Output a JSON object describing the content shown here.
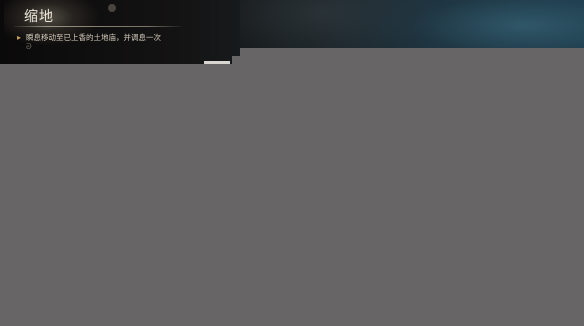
{
  "skill": {
    "title": "缩地",
    "description": "瞬息移动至已上香的土地庙，并调息一次",
    "arrow_icon": "▸",
    "swirl_icon": "ᘐ"
  },
  "colors": {
    "mask_gray": "#676565",
    "title_text": "#ece6da",
    "description_text": "#d8cfbf",
    "arrow_gold": "#c9a15a",
    "scene_teal": "#214050"
  },
  "icons": [
    "arrow-icon",
    "swirl-icon",
    "ink-burst-icon"
  ]
}
